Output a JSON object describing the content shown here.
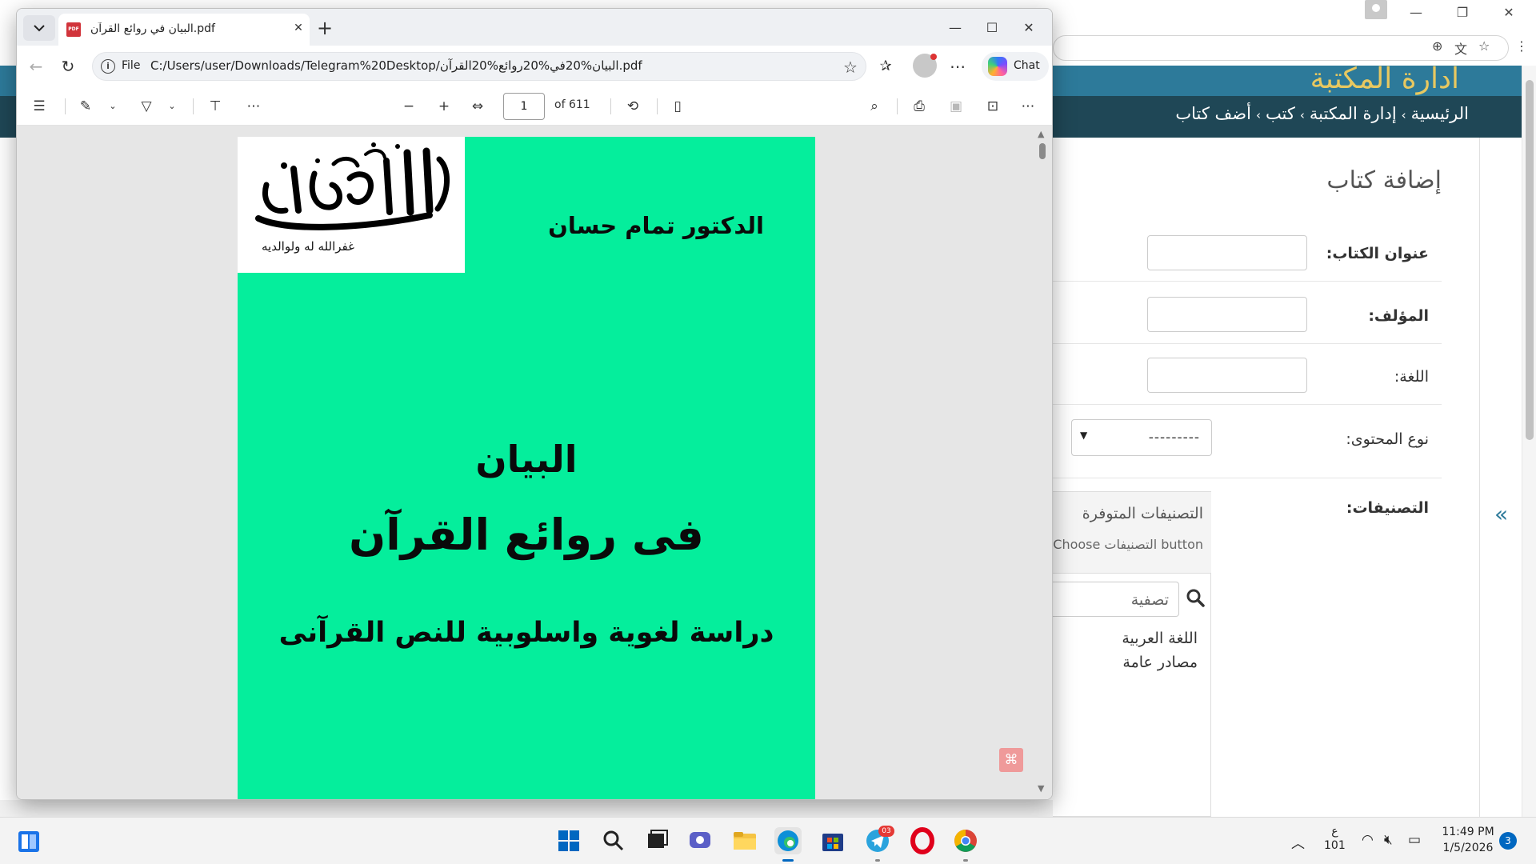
{
  "background_window": {
    "site_title": "ادارة المكتبة",
    "breadcrumb": [
      "الرئيسية",
      "إدارة المكتبة",
      "كتب",
      "أضف كتاب"
    ],
    "breadcrumb_separator": "›",
    "page_title": "إضافة كتاب",
    "form": {
      "book_title_label": "عنوان الكتاب:",
      "author_label": "المؤلف:",
      "language_label": "اللغة:",
      "content_type_label": "نوع المحتوى:",
      "content_type_value": "---------",
      "categories_label": "التصنيفات:"
    },
    "categories_widget": {
      "title": "التصنيفات المتوفرة",
      "hint": "Choose التصنيفات button",
      "filter_placeholder": "تصفية",
      "items": [
        "اللغة العربية",
        "مصادر عامة"
      ]
    },
    "sidebar_toggle": "«"
  },
  "pdf_window": {
    "tab_title": "البيان في روائع القرآن.pdf",
    "address": {
      "scheme": "File",
      "url": "C:/Users/user/Downloads/Telegram%20Desktop/البيان%20في%20روائع%20القرآن.pdf"
    },
    "chat_label": "Chat",
    "toolbar": {
      "page_number": "1",
      "page_total": "of 611"
    },
    "page": {
      "stamp_caption": "غفرالله له ولوالديه",
      "author": "الدكتور تمام حسان",
      "title_line1": "البيان",
      "title_line2": "فى روائع القرآن",
      "subtitle": "دراسة لغوية واسلوبية للنص القرآنى"
    }
  },
  "taskbar": {
    "lang_indicator": "ع",
    "lang_number": "101",
    "time": "11:49 PM",
    "date": "1/5/2026",
    "notification_count": "3",
    "telegram_badge": "03"
  },
  "colors": {
    "pdf_page_bg": "#05ee9c",
    "site_header": "#2d7a9a",
    "breadcrumb_bar": "#1f4756",
    "site_title": "#e8c860",
    "accent": "#0067c0"
  }
}
